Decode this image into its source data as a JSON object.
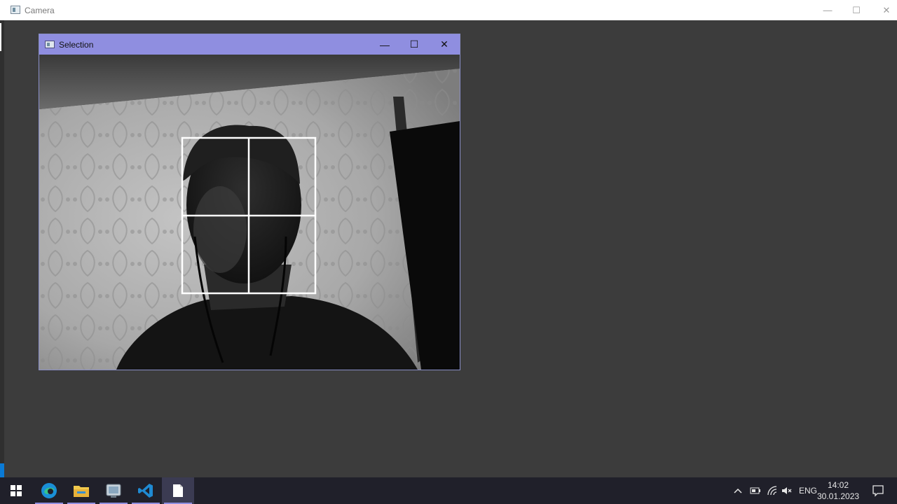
{
  "main_window": {
    "title": "Camera",
    "controls": {
      "minimize": "—",
      "maximize": "☐",
      "close": "✕"
    }
  },
  "selection_window": {
    "title": "Selection",
    "controls": {
      "minimize": "—",
      "maximize": "☐",
      "close": "✕"
    },
    "overlay": {
      "grid": "2x2",
      "color": "#ffffff"
    }
  },
  "taskbar": {
    "apps": [
      {
        "name": "start-icon"
      },
      {
        "name": "edge-icon"
      },
      {
        "name": "file-explorer-icon"
      },
      {
        "name": "app-icon"
      },
      {
        "name": "vscode-icon"
      },
      {
        "name": "document-icon",
        "active": true
      }
    ],
    "tray": {
      "language": "ENG",
      "time": "14:02",
      "date": "30.01.2023"
    }
  },
  "colors": {
    "desktop_bg": "#3c3c3c",
    "selection_title_bg": "#8f8ee0",
    "taskbar_bg": "#20202a",
    "accent": "#0a7ad6"
  }
}
